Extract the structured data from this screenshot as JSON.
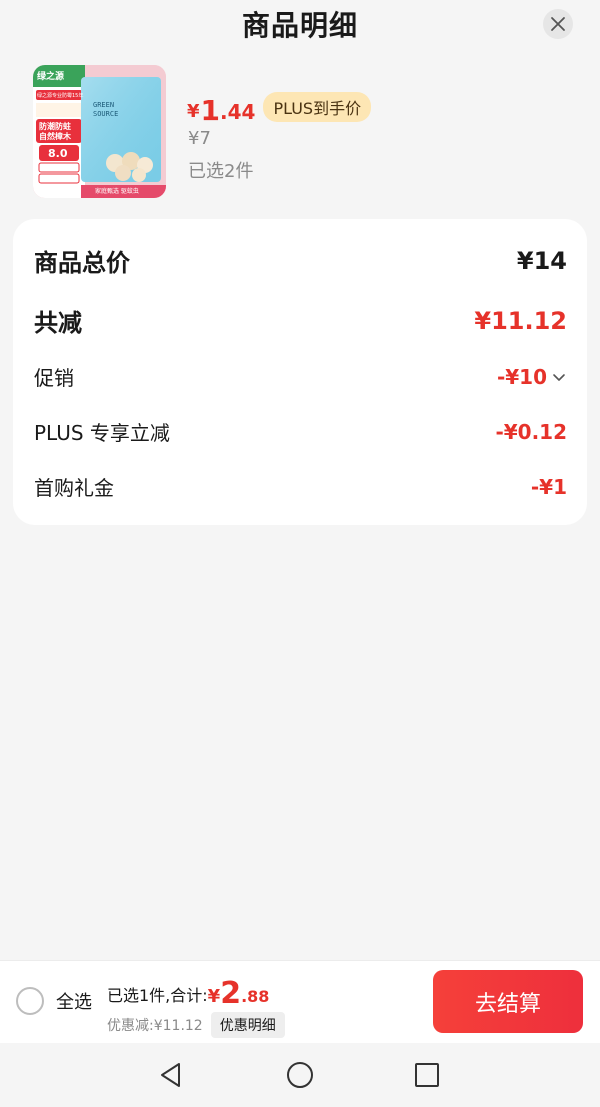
{
  "header": {
    "title": "商品明细"
  },
  "product": {
    "currency": "¥",
    "price_int": "1",
    "price_dec": ".44",
    "plus_tag": "PLUS到手价",
    "original_price": "¥7",
    "selected_qty": "已选2件",
    "thumbnail": {
      "brand": "绿之源",
      "pkg_line1": "GREEN",
      "pkg_line2": "SOURCE",
      "badge_top": "绿之源专业防霉15年",
      "tag1": "防潮防蛀",
      "tag2": "自然樟木",
      "count": "8.0",
      "footer": "家庭甄选 驱蚊虫"
    }
  },
  "summary": {
    "rows": [
      {
        "label": "商品总价",
        "value": "¥14"
      },
      {
        "label": "共减",
        "value": "¥11.12"
      },
      {
        "label": "促销",
        "value": "-¥10"
      },
      {
        "label": "PLUS 专享立减",
        "value": "-¥0.12"
      },
      {
        "label": "首购礼金",
        "value": "-¥1"
      }
    ]
  },
  "bottom": {
    "select_all": "全选",
    "total_prefix": "已选1件,合计:",
    "total_currency": "¥",
    "total_int": "2",
    "total_dec": ".88",
    "discount_text": "优惠减:¥11.12",
    "detail_button": "优惠明细",
    "checkout_button": "去结算"
  },
  "colors": {
    "accent_red": "#e6322a",
    "plus_tag_bg": "#fde6b4",
    "checkout": "#f23d3b"
  },
  "icons": [
    "close-icon",
    "chevron-down-icon",
    "nav-back-icon",
    "nav-home-icon",
    "nav-recent-icon"
  ]
}
